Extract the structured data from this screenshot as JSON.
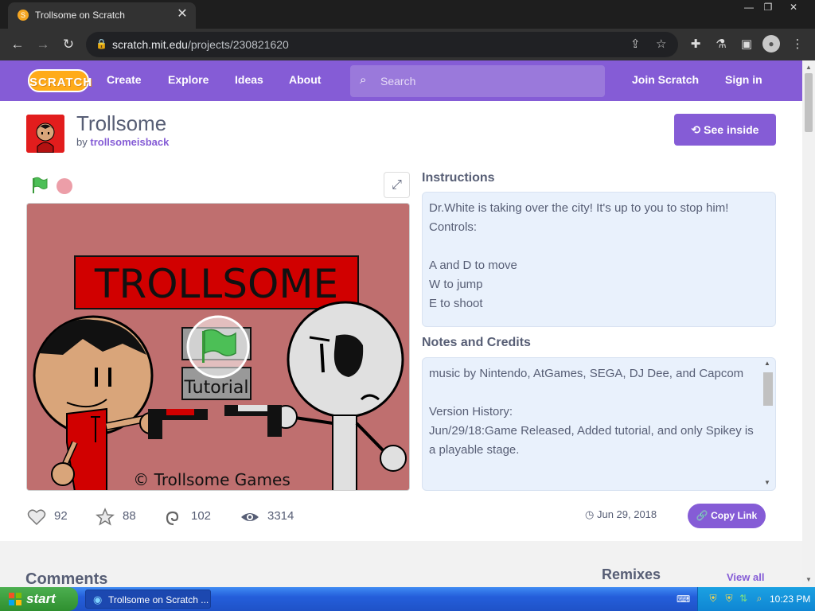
{
  "browser": {
    "tab_title": "Trollsome on Scratch",
    "tab_close": "✕",
    "url_host": "scratch.mit.edu",
    "url_path": "/projects/230821620"
  },
  "nav": {
    "logo": "SCRATCH",
    "links": [
      "Create",
      "Explore",
      "Ideas",
      "About"
    ],
    "search_placeholder": "Search",
    "join": "Join Scratch",
    "signin": "Sign in"
  },
  "project": {
    "title": "Trollsome",
    "by": "by",
    "author": "trollsomeisback",
    "see_inside": "See inside",
    "stage_title": "TROLLSOME",
    "stage_tutorial": "Tutorial",
    "stage_credit": "© Trollsome Games"
  },
  "instructions": {
    "heading": "Instructions",
    "text": "Dr.White is taking over the city! It's up to you to stop him!\nControls:\n\nA and D to move\nW to jump\nE to shoot"
  },
  "notes": {
    "heading": "Notes and Credits",
    "text": "music by Nintendo, AtGames, SEGA, DJ Dee, and Capcom\n\nVersion History:\nJun/29/18:Game Released, Added tutorial, and only Spikey is a playable stage."
  },
  "stats": {
    "loves": "92",
    "favorites": "88",
    "remixes": "102",
    "views": "3314",
    "date": "Jun 29, 2018",
    "copy_link": "Copy Link"
  },
  "lower": {
    "comments": "Comments",
    "remixes": "Remixes",
    "view_all": "View all"
  },
  "taskbar": {
    "start": "start",
    "task": "Trollsome on Scratch ...",
    "clock": "10:23 PM"
  },
  "colors": {
    "scratch_purple": "#855cd6",
    "scratch_orange": "#ffab19",
    "stage_bg": "#bf6f6f"
  }
}
